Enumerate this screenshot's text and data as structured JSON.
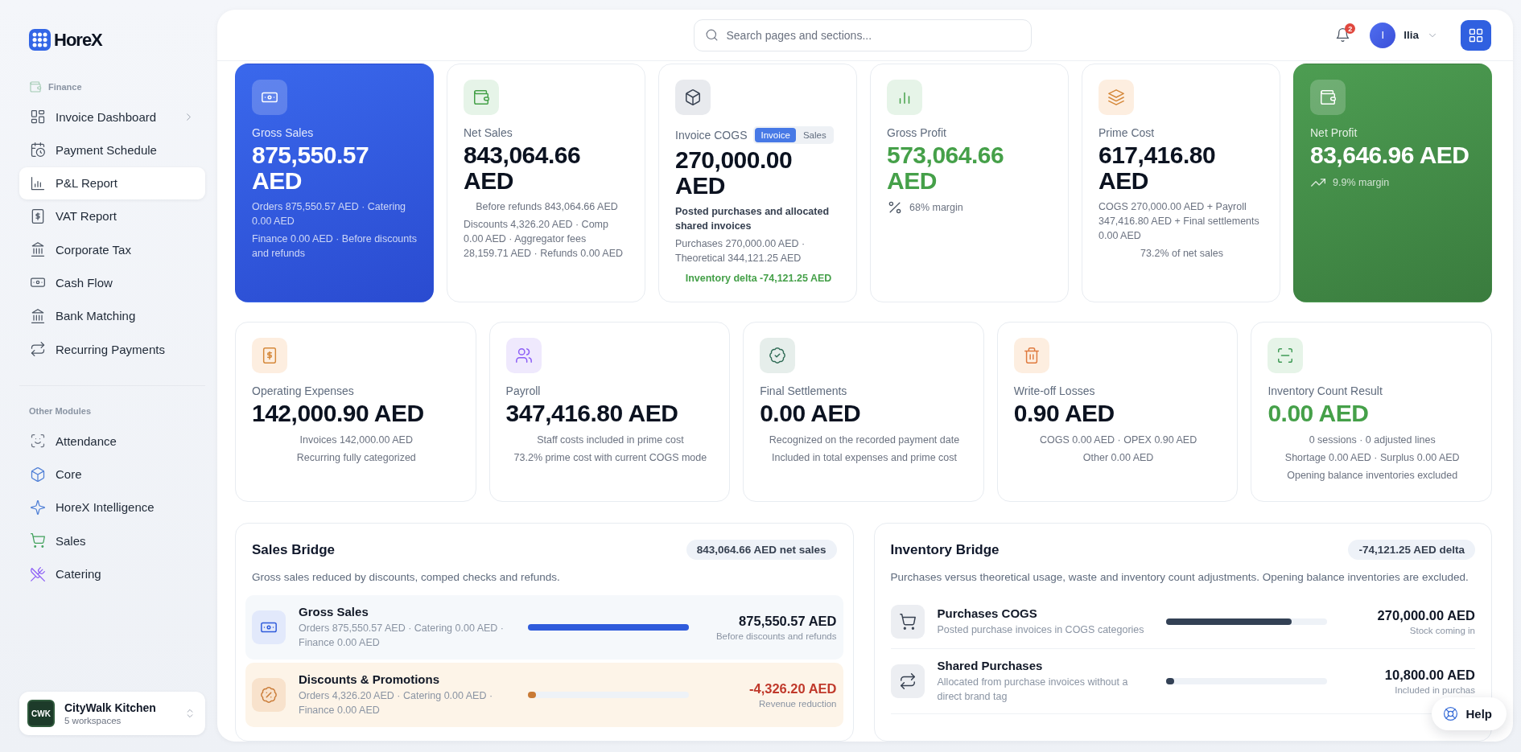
{
  "sidebar": {
    "brand": "HoreX",
    "sections": [
      {
        "title": "Finance",
        "items": [
          {
            "label": "Invoice Dashboard",
            "selected": false,
            "has_submenu": true
          },
          {
            "label": "Payment Schedule",
            "selected": false,
            "has_submenu": false
          },
          {
            "label": "P&L Report",
            "selected": true,
            "has_submenu": false
          },
          {
            "label": "VAT Report",
            "selected": false,
            "has_submenu": false
          },
          {
            "label": "Corporate Tax",
            "selected": false,
            "has_submenu": false
          },
          {
            "label": "Cash Flow",
            "selected": false,
            "has_submenu": false
          },
          {
            "label": "Bank Matching",
            "selected": false,
            "has_submenu": false
          },
          {
            "label": "Recurring Payments",
            "selected": false,
            "has_submenu": false
          }
        ]
      },
      {
        "title": "Other Modules",
        "items": [
          {
            "label": "Attendance",
            "selected": false,
            "has_submenu": false
          },
          {
            "label": "Core",
            "selected": false,
            "has_submenu": false
          },
          {
            "label": "HoreX Intelligence",
            "selected": false,
            "has_submenu": false
          },
          {
            "label": "Sales",
            "selected": false,
            "has_submenu": false
          },
          {
            "label": "Catering",
            "selected": false,
            "has_submenu": false
          }
        ]
      }
    ],
    "workspace": {
      "logo_text": "CWK",
      "name": "CityWalk Kitchen",
      "detail": "5 workspaces"
    }
  },
  "header": {
    "search": {
      "placeholder": "Search pages and sections..."
    },
    "notifications": {
      "badge": "2"
    },
    "user": {
      "initial": "I",
      "name": "Ilia"
    }
  },
  "kpi_cards": [
    {
      "kind": "primary",
      "label": "Gross Sales",
      "value": "875,550.57 AED",
      "positive": false,
      "lines": [
        {
          "kind": "detail",
          "text": "Orders 875,550.57 AED · Catering 0.00 AED"
        },
        {
          "kind": "detail",
          "text": "Finance 0.00 AED · Before discounts and refunds"
        }
      ]
    },
    {
      "kind": "plain",
      "label": "Net Sales",
      "value": "843,064.66 AED",
      "positive": false,
      "lines": [
        {
          "kind": "center",
          "text": "Before refunds 843,064.66 AED"
        },
        {
          "kind": "detail",
          "text": "Discounts 4,326.20 AED · Comp 0.00 AED · Aggregator fees 28,159.71 AED · Refunds 0.00 AED"
        }
      ]
    },
    {
      "kind": "plain",
      "label": "Invoice COGS",
      "value": "270,000.00 AED",
      "positive": false,
      "toggle": [
        {
          "label": "Invoice",
          "selected": true
        },
        {
          "label": "Sales",
          "selected": false
        }
      ],
      "lines": [
        {
          "kind": "bold",
          "text": "Posted purchases and allocated shared invoices"
        },
        {
          "kind": "detail",
          "text": "Purchases 270,000.00 AED · Theoretical 344,121.25 AED"
        },
        {
          "kind": "delta",
          "text": "Inventory delta -74,121.25 AED"
        }
      ]
    },
    {
      "kind": "plain",
      "label": "Gross Profit",
      "value": "573,064.66 AED",
      "positive": true,
      "lines": [
        {
          "kind": "margin",
          "text": "68% margin"
        }
      ]
    },
    {
      "kind": "plain",
      "label": "Prime Cost",
      "value": "617,416.80 AED",
      "positive": false,
      "lines": [
        {
          "kind": "detail",
          "text": "COGS 270,000.00 AED + Payroll 347,416.80 AED + Final settlements 0.00 AED"
        },
        {
          "kind": "center",
          "text": "73.2% of net sales"
        }
      ]
    },
    {
      "kind": "success",
      "label": "Net Profit",
      "value": "83,646.96 AED",
      "positive": false,
      "lines": [
        {
          "kind": "margin",
          "text": "9.9% margin"
        }
      ]
    }
  ],
  "metric_cards": [
    {
      "label": "Operating Expenses",
      "value": "142,000.90 AED",
      "positive": false,
      "lines": [
        {
          "kind": "center",
          "text": "Invoices 142,000.00 AED"
        },
        {
          "kind": "center",
          "text": "Recurring fully categorized"
        }
      ]
    },
    {
      "label": "Payroll",
      "value": "347,416.80 AED",
      "positive": false,
      "lines": [
        {
          "kind": "center",
          "text": "Staff costs included in prime cost"
        },
        {
          "kind": "center",
          "text": "73.2% prime cost with current COGS mode"
        }
      ]
    },
    {
      "label": "Final Settlements",
      "value": "0.00 AED",
      "positive": false,
      "lines": [
        {
          "kind": "center",
          "text": "Recognized on the recorded payment date"
        },
        {
          "kind": "center",
          "text": "Included in total expenses and prime cost"
        }
      ]
    },
    {
      "label": "Write-off Losses",
      "value": "0.90 AED",
      "positive": false,
      "lines": [
        {
          "kind": "center",
          "text": "COGS 0.00 AED · OPEX 0.90 AED"
        },
        {
          "kind": "center",
          "text": "Other 0.00 AED"
        }
      ]
    },
    {
      "label": "Inventory Count Result",
      "value": "0.00 AED",
      "positive": true,
      "lines": [
        {
          "kind": "center",
          "text": "0 sessions · 0 adjusted lines"
        },
        {
          "kind": "center",
          "text": "Shortage 0.00 AED · Surplus 0.00 AED"
        },
        {
          "kind": "center",
          "text": "Opening balance inventories excluded"
        }
      ]
    }
  ],
  "bridges": [
    {
      "title": "Sales Bridge",
      "badge": "843,064.66 AED net sales",
      "description": "Gross sales reduced by discounts, comped checks and refunds.",
      "rows": [
        {
          "kind": "revenue",
          "title": "Gross Sales",
          "detail": "Orders 875,550.57 AED · Catering 0.00 AED · Finance 0.00 AED",
          "level": 1.0,
          "color": "#2f5bdb",
          "amount": "875,550.57 AED",
          "caption": "Before discounts and refunds"
        },
        {
          "kind": "reduction",
          "title": "Discounts & Promotions",
          "detail": "Orders 4,326.20 AED · Catering 0.00 AED · Finance 0.00 AED",
          "level": 0.005,
          "color": "#c97a35",
          "amount": "-4,326.20 AED",
          "caption": "Revenue reduction"
        }
      ]
    },
    {
      "title": "Inventory Bridge",
      "badge": "-74,121.25 AED delta",
      "description": "Purchases versus theoretical usage, waste and inventory count adjustments. Opening balance inventories are excluded.",
      "rows": [
        {
          "kind": "plain",
          "title": "Purchases COGS",
          "detail": "Posted purchase invoices in COGS categories",
          "level": 0.78,
          "color": "#334155",
          "amount": "270,000.00 AED",
          "caption": "Stock coming in"
        },
        {
          "kind": "plain",
          "title": "Shared Purchases",
          "detail": "Allocated from purchase invoices without a direct brand tag",
          "level": 0.03,
          "color": "#334155",
          "amount": "10,800.00 AED",
          "caption": "Included in purchas"
        }
      ]
    }
  ],
  "help_button": {
    "label": "Help"
  }
}
